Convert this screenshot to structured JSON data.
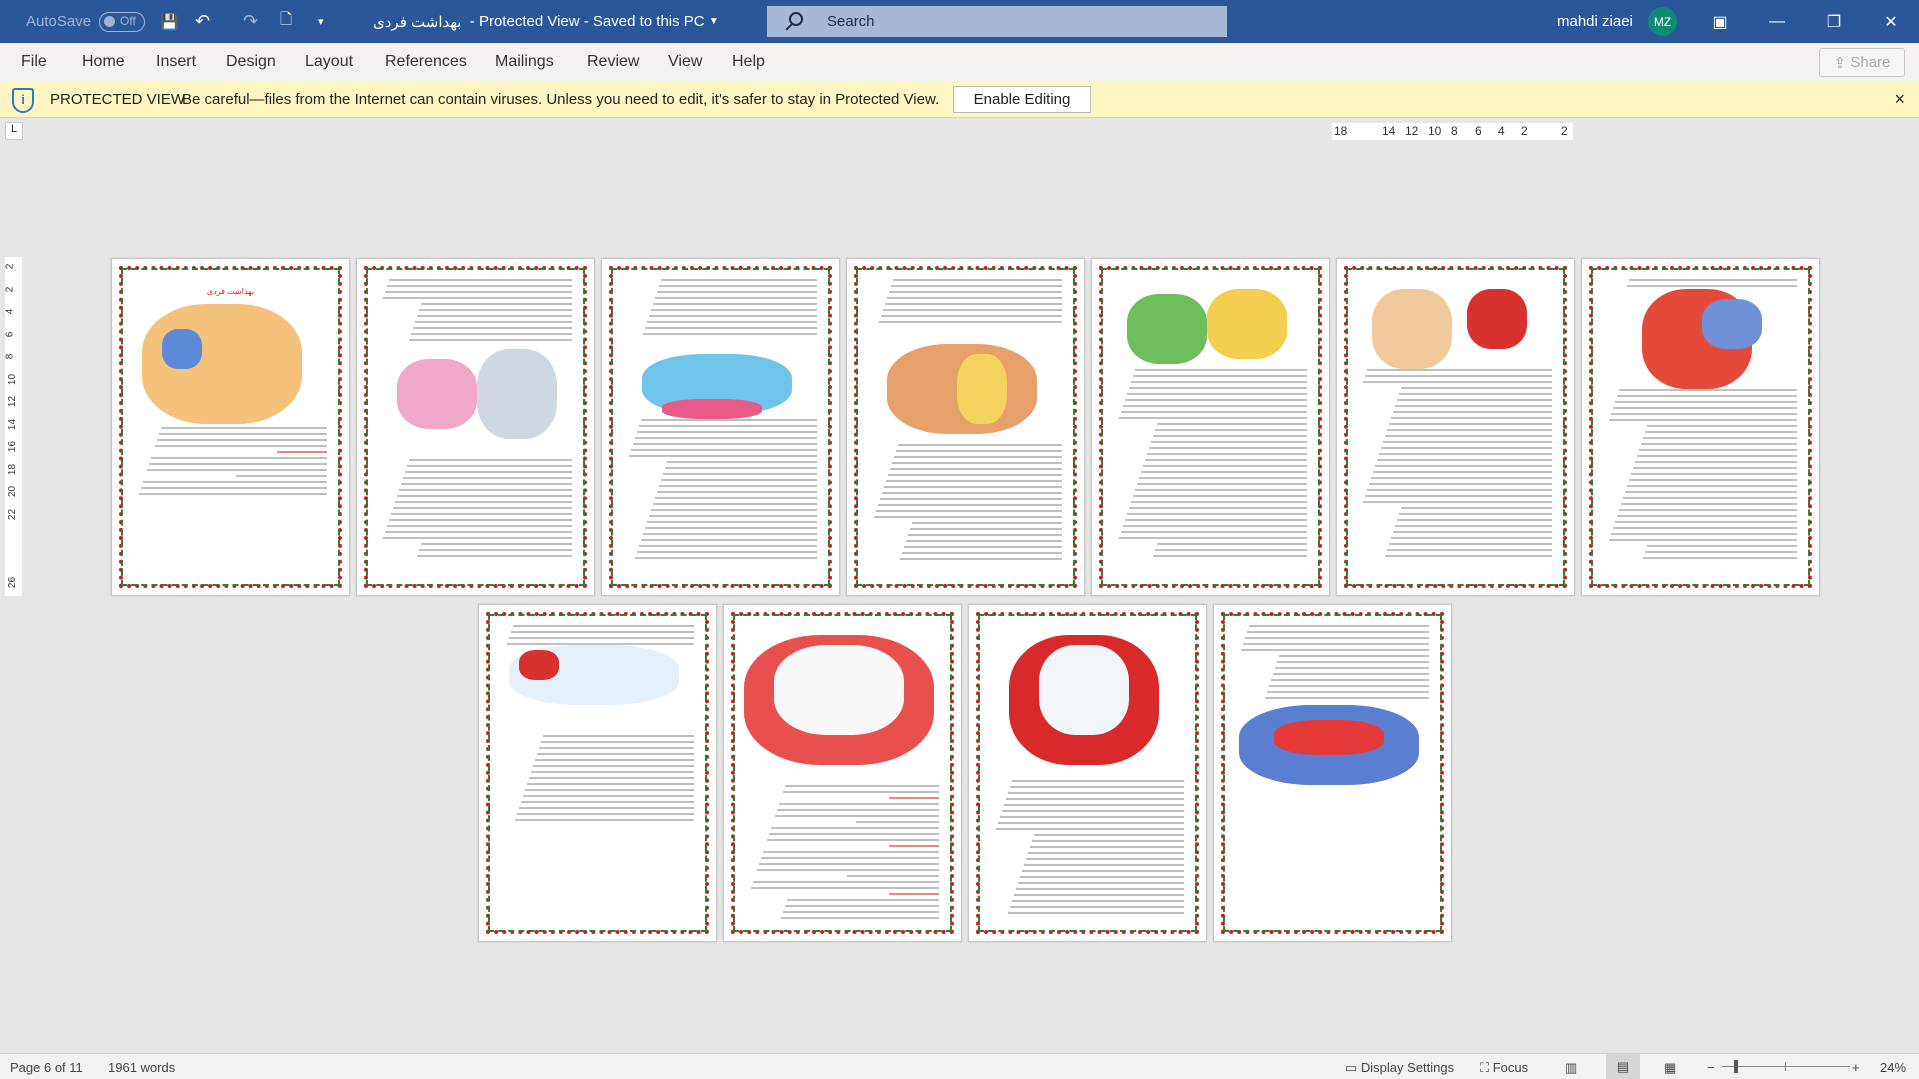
{
  "titlebar": {
    "autosave_label": "AutoSave",
    "autosave_state": "Off",
    "doc_title": "بهداشت فردی",
    "status": "Protected View  -  Saved to this PC",
    "search_placeholder": "Search",
    "user_name": "mahdi ziaei",
    "user_initials": "MZ"
  },
  "menu": {
    "items": [
      "File",
      "Home",
      "Insert",
      "Design",
      "Layout",
      "References",
      "Mailings",
      "Review",
      "View",
      "Help"
    ],
    "share_label": "Share"
  },
  "protected_view": {
    "title": "PROTECTED VIEW",
    "message": "Be careful—files from the Internet can contain viruses. Unless you need to edit, it's safer to stay in Protected View.",
    "enable_label": "Enable Editing",
    "close_label": "×"
  },
  "ruler": {
    "horizontal": [
      "18",
      "14",
      "12",
      "10",
      "8",
      "6",
      "4",
      "2",
      "2"
    ],
    "vertical": [
      "2",
      "2",
      "4",
      "6",
      "8",
      "10",
      "12",
      "14",
      "16",
      "18",
      "20",
      "22",
      "26"
    ]
  },
  "document": {
    "page_count": 11,
    "first_page_title": "بهداشت فردی",
    "accent_border": "#c0202a",
    "accent_border2": "#2e7d32"
  },
  "statusbar": {
    "page_info": "Page 6 of 11",
    "word_count": "1961 words",
    "display_settings": "Display Settings",
    "focus": "Focus",
    "zoom_level": "24%",
    "zoom_percent": 24
  }
}
